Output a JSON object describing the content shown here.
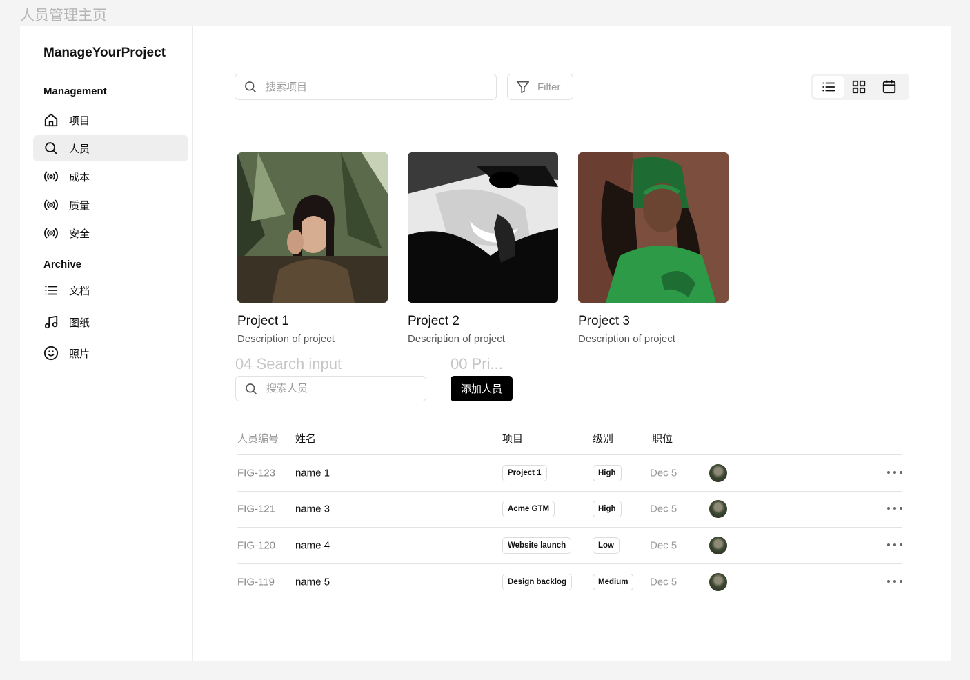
{
  "page_label": "人员管理主页",
  "brand": "ManageYourProject",
  "sidebar": {
    "management_title": "Management",
    "management_items": [
      {
        "label": "项目",
        "icon": "home-icon"
      },
      {
        "label": "人员",
        "icon": "search-icon",
        "active": true
      },
      {
        "label": "成本",
        "icon": "broadcast-icon"
      },
      {
        "label": "质量",
        "icon": "broadcast-icon"
      },
      {
        "label": "安全",
        "icon": "broadcast-icon"
      }
    ],
    "archive_title": "Archive",
    "archive_items": [
      {
        "label": "文档",
        "icon": "list-icon"
      },
      {
        "label": "图纸",
        "icon": "music-note-icon"
      },
      {
        "label": "照片",
        "icon": "smiley-icon"
      }
    ]
  },
  "toolbar": {
    "search_placeholder": "搜索项目",
    "filter_label": "Filter",
    "views": [
      "list-view-icon",
      "grid-view-icon",
      "calendar-view-icon"
    ],
    "active_view": "list-view-icon"
  },
  "projects": [
    {
      "title": "Project 1",
      "description": "Description of project"
    },
    {
      "title": "Project 2",
      "description": "Description of project"
    },
    {
      "title": "Project 3",
      "description": "Description of project"
    }
  ],
  "people_section": {
    "search_label": "04 Search input",
    "primary_label": "00 Pri...",
    "search_placeholder": "搜索人员",
    "add_button": "添加人员"
  },
  "table": {
    "headers": [
      "人员编号",
      "姓名",
      "项目",
      "级别",
      "职位"
    ],
    "rows": [
      {
        "id": "FIG-123",
        "name": "name 1",
        "project": "Project 1",
        "level": "High",
        "position": "Dec 5"
      },
      {
        "id": "FIG-121",
        "name": "name 3",
        "project": "Acme GTM",
        "level": "High",
        "position": "Dec 5"
      },
      {
        "id": "FIG-120",
        "name": "name 4",
        "project": "Website launch",
        "level": "Low",
        "position": "Dec 5"
      },
      {
        "id": "FIG-119",
        "name": "name 5",
        "project": "Design backlog",
        "level": "Medium",
        "position": "Dec 5"
      }
    ]
  },
  "colors": {
    "accent": "#000000",
    "active_nav_bg": "#eeeeee",
    "page_bg": "#f4f4f4"
  }
}
